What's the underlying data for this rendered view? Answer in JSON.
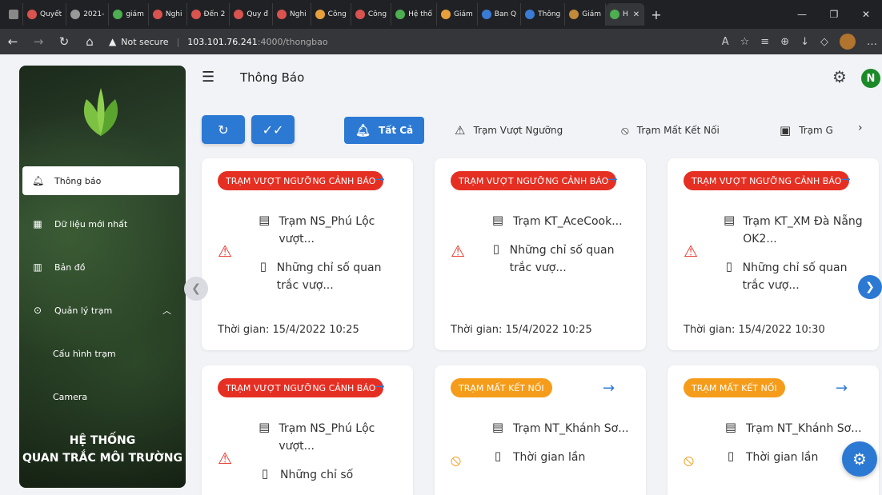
{
  "browser": {
    "tabs": [
      {
        "label": "",
        "color": "#888888"
      },
      {
        "label": "Quyết",
        "color": "#d9534f"
      },
      {
        "label": "2021-",
        "color": "#999999"
      },
      {
        "label": "giám",
        "color": "#4caf50"
      },
      {
        "label": "Nghi",
        "color": "#d9534f"
      },
      {
        "label": "Đến 2",
        "color": "#d9534f"
      },
      {
        "label": "Quy đ",
        "color": "#d9534f"
      },
      {
        "label": "Nghi",
        "color": "#d9534f"
      },
      {
        "label": "Công",
        "color": "#e8a03a"
      },
      {
        "label": "Công",
        "color": "#d9534f"
      },
      {
        "label": "Hệ thố",
        "color": "#4caf50"
      },
      {
        "label": "Giám",
        "color": "#e8a03a"
      },
      {
        "label": "Ban Q",
        "color": "#3a7bd5"
      },
      {
        "label": "Thông",
        "color": "#3a7bd5"
      },
      {
        "label": "Giám",
        "color": "#c08a3a"
      },
      {
        "label": "H",
        "color": "#4caf50"
      }
    ],
    "url_warning": "Not secure",
    "url_host": "103.101.76.241",
    "url_path": ":4000/thongbao"
  },
  "sidebar": {
    "items": [
      {
        "label": "Thông báo",
        "icon": "bell-icon"
      },
      {
        "label": "Dữ liệu mới nhất",
        "icon": "dashboard-icon"
      },
      {
        "label": "Bản đồ",
        "icon": "map-icon"
      },
      {
        "label": "Quản lý trạm",
        "icon": "location-pin-icon"
      },
      {
        "label": "Cấu hình trạm",
        "icon": ""
      },
      {
        "label": "Camera",
        "icon": ""
      }
    ],
    "brand_line1": "HỆ THỐNG",
    "brand_line2": "QUAN TRẮC MÔI TRƯỜNG"
  },
  "header": {
    "title": "Thông Báo",
    "avatar_letter": "N"
  },
  "filters": [
    {
      "label": "Tất Cả",
      "icon": "bell-icon",
      "active": true
    },
    {
      "label": "Trạm Vượt Ngưỡng",
      "icon": "warning-icon",
      "active": false
    },
    {
      "label": "Trạm Mất Kết Nối",
      "icon": "signal-off-icon",
      "active": false
    },
    {
      "label": "Trạm G",
      "icon": "chart-icon",
      "active": false
    }
  ],
  "cards": [
    {
      "badge": "TRẠM VƯỢT NGƯỠNG CẢNH BÁO",
      "type": "red",
      "line1": "Trạm NS_Phú Lộc vượt...",
      "line2": "Những chỉ số quan trắc vượ...",
      "time": "Thời gian: 15/4/2022 10:25"
    },
    {
      "badge": "TRẠM VƯỢT NGƯỠNG CẢNH BÁO",
      "type": "red",
      "line1": "Trạm KT_AceCook...",
      "line2": "Những chỉ số quan trắc vượ...",
      "time": "Thời gian: 15/4/2022 10:25"
    },
    {
      "badge": "TRẠM VƯỢT NGƯỠNG CẢNH BÁO",
      "type": "red",
      "line1": "Trạm KT_XM Đà Nẵng OK2...",
      "line2": "Những chỉ số quan trắc vượ...",
      "time": "Thời gian: 15/4/2022 10:30"
    },
    {
      "badge": "TRẠM VƯỢT NGƯỠNG CẢNH BÁO",
      "type": "red",
      "line1": "Trạm NS_Phú Lộc vượt...",
      "line2": "Những chỉ số",
      "time": ""
    },
    {
      "badge": "TRẠM MẤT KẾT NỐI",
      "type": "orange",
      "line1": "Trạm NT_Khánh Sơ...",
      "line2": "Thời gian lần",
      "time": ""
    },
    {
      "badge": "TRẠM MẤT KẾT NỐI",
      "type": "orange",
      "line1": "Trạm NT_Khánh Sơ...",
      "line2": "Thời gian lần",
      "time": ""
    }
  ]
}
